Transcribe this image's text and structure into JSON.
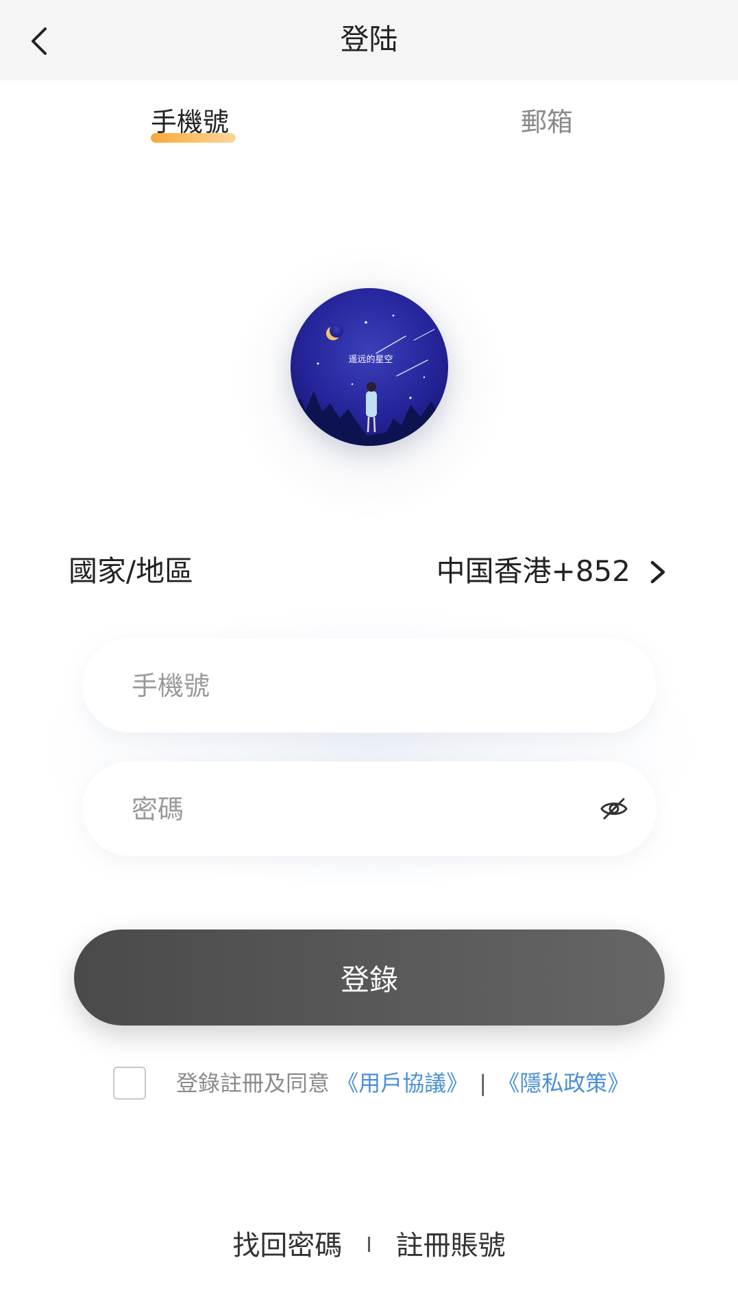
{
  "nav": {
    "title": "登陆",
    "back_icon": "chevron-left-icon"
  },
  "tabs": [
    {
      "label": "手機號",
      "active": true
    },
    {
      "label": "郵箱",
      "active": false
    }
  ],
  "avatar": {
    "caption": "遥远的星空"
  },
  "region": {
    "label": "國家/地區",
    "value": "中国香港+852",
    "icon": "chevron-right-icon"
  },
  "form": {
    "phone_placeholder": "手機號",
    "password_placeholder": "密碼",
    "password_visibility_icon": "eye-off-icon"
  },
  "login_button": "登錄",
  "agreement": {
    "checked": false,
    "text": "登錄註冊及同意",
    "user_agreement": "《用戶協議》",
    "separator": "|",
    "privacy_policy": "《隱私政策》"
  },
  "footer": {
    "forgot_password": "找回密碼",
    "separator": "I",
    "register": "註冊賬號"
  },
  "colors": {
    "accent_underline": "#f7a93a",
    "link": "#4a8fd6",
    "button": "#555555",
    "nav_bg": "#f5f5f5"
  }
}
